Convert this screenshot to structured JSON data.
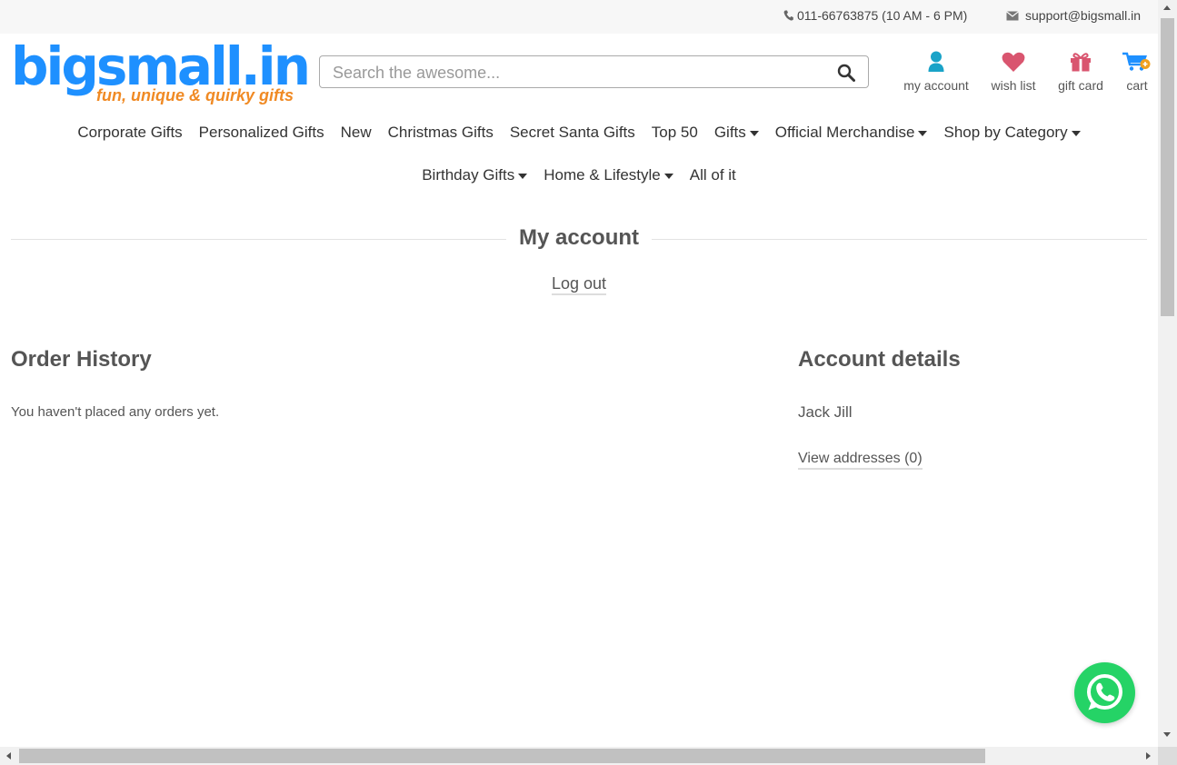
{
  "topbar": {
    "phone": "011-66763875 (10 AM - 6 PM)",
    "email": "support@bigsmall.in",
    "phone_icon": "phone-icon",
    "email_icon": "envelope-icon"
  },
  "logo": {
    "brand": "bigsmall.in",
    "tagline": "fun, unique & quirky gifts"
  },
  "search": {
    "placeholder": "Search the awesome...",
    "value": "",
    "icon": "search-icon"
  },
  "quicklinks": {
    "account": "my account",
    "wishlist": "wish list",
    "giftcard": "gift card",
    "cart": "cart"
  },
  "nav": {
    "row1": [
      "Corporate Gifts",
      "Personalized Gifts",
      "New",
      "Christmas Gifts",
      "Secret Santa Gifts",
      "Top 50",
      "Gifts",
      "Official Merchandise",
      "Shop by Category"
    ],
    "row2": [
      "Birthday Gifts",
      "Home & Lifestyle",
      "All of it"
    ]
  },
  "page": {
    "title": "My account",
    "logout": "Log out"
  },
  "orders": {
    "heading": "Order History",
    "empty_text": "You haven't placed any orders yet."
  },
  "account": {
    "heading": "Account details",
    "name": "Jack Jill",
    "addresses_link": "View addresses (0)"
  },
  "colors": {
    "brand_blue": "#1e90ff",
    "brand_orange": "#f08a24",
    "whatsapp": "#25d366",
    "account_icon": "#1aa3c8",
    "wishlist_icon": "#d9556f",
    "giftcard_icon": "#d9556f"
  }
}
